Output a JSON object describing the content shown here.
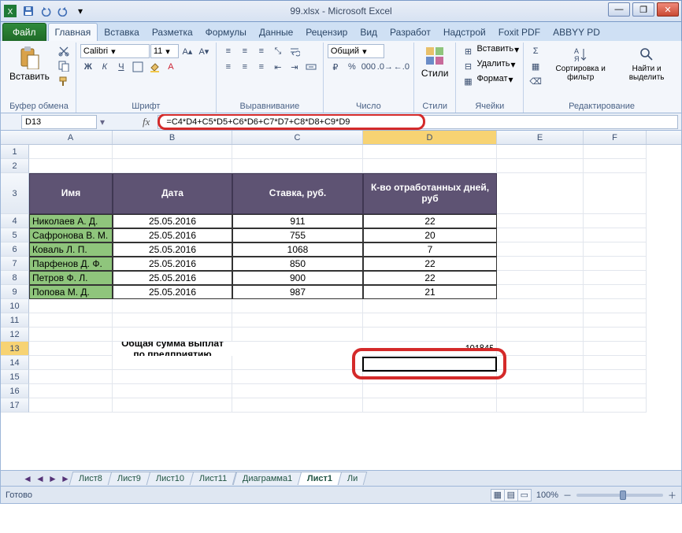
{
  "window": {
    "title": "99.xlsx - Microsoft Excel"
  },
  "tabs": {
    "file": "Файл",
    "items": [
      "Главная",
      "Вставка",
      "Разметка",
      "Формулы",
      "Данные",
      "Рецензир",
      "Вид",
      "Разработ",
      "Надстрой",
      "Foxit PDF",
      "ABBYY PD"
    ],
    "active": 0
  },
  "ribbon": {
    "clipboard": {
      "label": "Буфер обмена",
      "paste": "Вставить"
    },
    "font": {
      "label": "Шрифт",
      "name": "Calibri",
      "size": "11",
      "bold": "Ж",
      "italic": "К",
      "underline": "Ч"
    },
    "align": {
      "label": "Выравнивание"
    },
    "number": {
      "label": "Число",
      "format": "Общий"
    },
    "styles": {
      "label": "Стили",
      "btn": "Стили"
    },
    "cells": {
      "label": "Ячейки",
      "insert": "Вставить",
      "delete": "Удалить",
      "format": "Формат"
    },
    "editing": {
      "label": "Редактирование",
      "sort": "Сортировка и фильтр",
      "find": "Найти и выделить"
    }
  },
  "namebox": "D13",
  "formula": "=C4*D4+C5*D5+C6*D6+C7*D7+C8*D8+C9*D9",
  "columns": [
    "A",
    "B",
    "C",
    "D",
    "E",
    "F"
  ],
  "row_numbers": [
    "1",
    "2",
    "3",
    "4",
    "5",
    "6",
    "7",
    "8",
    "9",
    "10",
    "11",
    "12",
    "13",
    "14",
    "15",
    "16",
    "17"
  ],
  "table": {
    "headers": {
      "name": "Имя",
      "date": "Дата",
      "rate": "Ставка, руб.",
      "days": "К-во отработанных дней, руб"
    },
    "rows": [
      {
        "name": "Николаев А. Д.",
        "date": "25.05.2016",
        "rate": "911",
        "days": "22"
      },
      {
        "name": "Сафронова В. М.",
        "date": "25.05.2016",
        "rate": "755",
        "days": "20"
      },
      {
        "name": "Коваль Л. П.",
        "date": "25.05.2016",
        "rate": "1068",
        "days": "7"
      },
      {
        "name": "Парфенов Д. Ф.",
        "date": "25.05.2016",
        "rate": "850",
        "days": "22"
      },
      {
        "name": "Петров Ф. Л.",
        "date": "25.05.2016",
        "rate": "900",
        "days": "22"
      },
      {
        "name": "Попова М. Д.",
        "date": "25.05.2016",
        "rate": "987",
        "days": "21"
      }
    ],
    "total_label": "Общая сумма выплат по предприятию",
    "total_value": "101845"
  },
  "sheets": {
    "tabs": [
      "Лист8",
      "Лист9",
      "Лист10",
      "Лист11",
      "Диаграмма1",
      "Лист1",
      "Ли"
    ],
    "active": 5
  },
  "status": {
    "ready": "Готово",
    "zoom": "100%"
  },
  "icons": {
    "sigma": "Σ",
    "dash": "—",
    "dn": "▾",
    "lt": "◄",
    "rt": "►",
    "plus": "＋",
    "minus": "－"
  }
}
